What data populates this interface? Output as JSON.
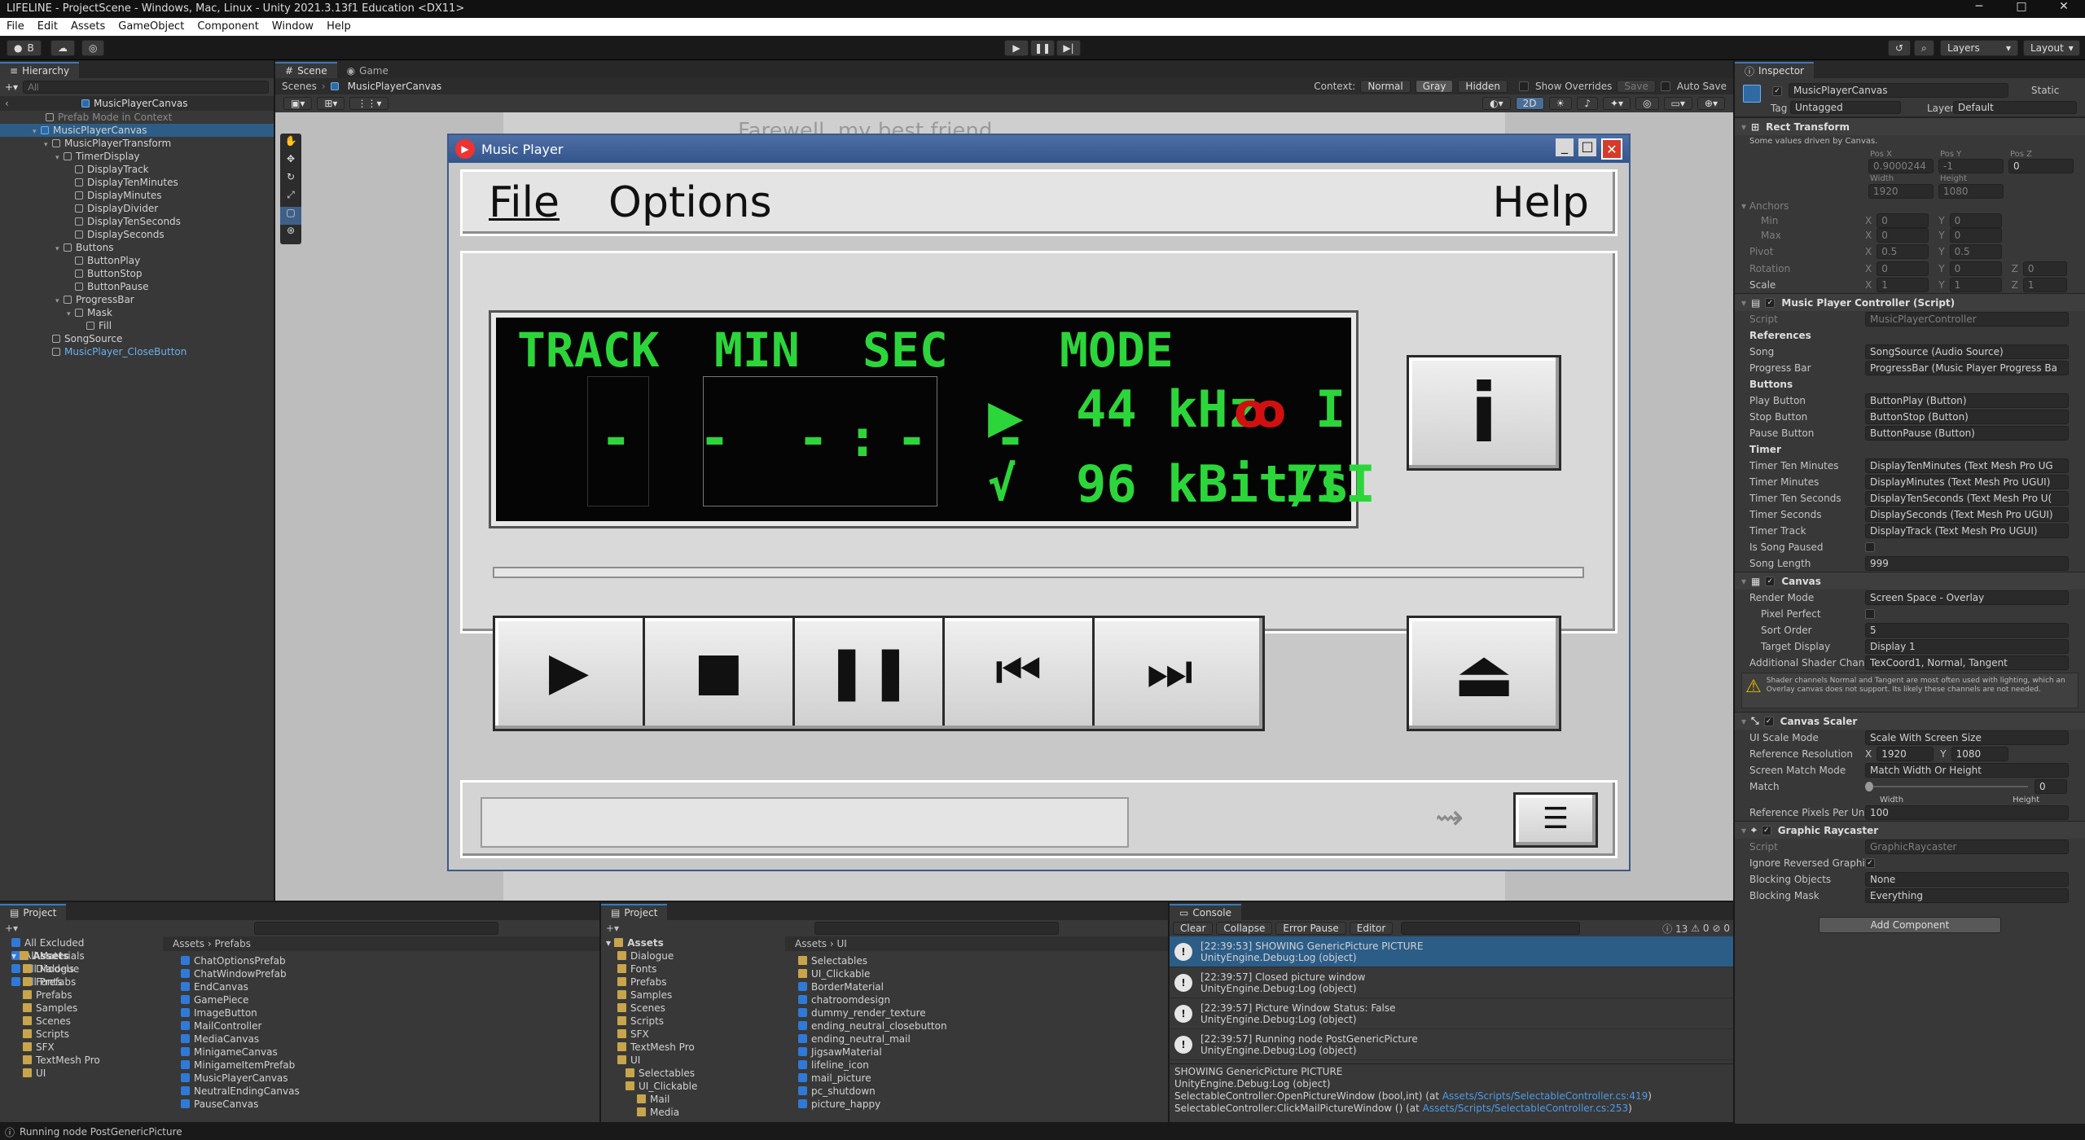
{
  "window": {
    "title": "LIFELINE - ProjectScene - Windows, Mac, Linux - Unity 2021.3.13f1 Education <DX11>",
    "controls": [
      "─",
      "□",
      "✕"
    ]
  },
  "menu": [
    "File",
    "Edit",
    "Assets",
    "GameObject",
    "Component",
    "Window",
    "Help"
  ],
  "toolbar": {
    "account": "B",
    "layers": "Layers",
    "layout": "Layout"
  },
  "hierarchy": {
    "tab": "Hierarchy",
    "search_placeholder": "All",
    "root": "MusicPlayerCanvas",
    "mode_label": "Prefab Mode in Context",
    "items": [
      {
        "label": "MusicPlayerCanvas",
        "depth": 1,
        "selected": true
      },
      {
        "label": "MusicPlayerTransform",
        "depth": 2
      },
      {
        "label": "TimerDisplay",
        "depth": 3
      },
      {
        "label": "DisplayTrack",
        "depth": 4
      },
      {
        "label": "DisplayTenMinutes",
        "depth": 4
      },
      {
        "label": "DisplayMinutes",
        "depth": 4
      },
      {
        "label": "DisplayDivider",
        "depth": 4
      },
      {
        "label": "DisplayTenSeconds",
        "depth": 4
      },
      {
        "label": "DisplaySeconds",
        "depth": 4
      },
      {
        "label": "Buttons",
        "depth": 3
      },
      {
        "label": "ButtonPlay",
        "depth": 4
      },
      {
        "label": "ButtonStop",
        "depth": 4
      },
      {
        "label": "ButtonPause",
        "depth": 4
      },
      {
        "label": "ProgressBar",
        "depth": 3
      },
      {
        "label": "Mask",
        "depth": 4
      },
      {
        "label": "Fill",
        "depth": 5
      },
      {
        "label": "SongSource",
        "depth": 2
      },
      {
        "label": "MusicPlayer_CloseButton",
        "depth": 2
      }
    ]
  },
  "scene": {
    "tabs": [
      "Scene",
      "Game"
    ],
    "breadcrumb": [
      "Scenes",
      "MusicPlayerCanvas"
    ],
    "context_label": "Context:",
    "context_options": [
      "Normal",
      "Gray",
      "Hidden"
    ],
    "show_overrides": "Show Overrides",
    "save": "Save",
    "auto_save": "Auto Save",
    "mode2d": "2D",
    "bg_text": "Farewell, my best friend"
  },
  "music_player": {
    "title": "Music Player",
    "menu": [
      "File",
      "Options",
      "Help"
    ],
    "lcd_headers": [
      "TRACK",
      "MIN",
      "SEC",
      "MODE"
    ],
    "lcd_digits": "-  - -:- -",
    "freq": "44 kHz",
    "stereo": "I",
    "bitrate": "96 kBit/s",
    "check": "√",
    "level": "III",
    "info_btn": "i",
    "transport": [
      "▶",
      "■",
      "❚❚",
      "⏮",
      "⏭"
    ],
    "eject": "⏏"
  },
  "inspector": {
    "tab": "Inspector",
    "object_name": "MusicPlayerCanvas",
    "static": "Static",
    "tag_label": "Tag",
    "tag_value": "Untagged",
    "layer_label": "Layer",
    "layer_value": "Default",
    "rect": {
      "title": "Rect Transform",
      "note": "Some values driven by Canvas.",
      "pos_labels": [
        "Pos X",
        "Pos Y",
        "Pos Z"
      ],
      "pos_values": [
        "0.9000244",
        "-1",
        "0"
      ],
      "size_labels": [
        "Width",
        "Height"
      ],
      "size_values": [
        "1920",
        "1080"
      ],
      "anchors": "Anchors",
      "min": "Min",
      "min_x": "0",
      "min_y": "0",
      "max": "Max",
      "max_x": "0",
      "max_y": "0",
      "pivot": "Pivot",
      "pivot_x": "0.5",
      "pivot_y": "0.5",
      "rotation": "Rotation",
      "rot": [
        "0",
        "0",
        "0"
      ],
      "scale": "Scale",
      "scl": [
        "1",
        "1",
        "1"
      ]
    },
    "controller": {
      "title": "Music Player Controller (Script)",
      "script_label": "Script",
      "script_value": "MusicPlayerController",
      "references": "References",
      "song_label": "Song",
      "song_value": "SongSource (Audio Source)",
      "progress_label": "Progress Bar",
      "progress_value": "ProgressBar (Music Player Progress Ba",
      "buttons": "Buttons",
      "play_label": "Play Button",
      "play_value": "ButtonPlay (Button)",
      "stop_label": "Stop Button",
      "stop_value": "ButtonStop (Button)",
      "pause_label": "Pause Button",
      "pause_value": "ButtonPause (Button)",
      "timer": "Timer",
      "tt_label": "Timer Ten Minutes",
      "tt_value": "DisplayTenMinutes (Text Mesh Pro UG",
      "tm_label": "Timer Minutes",
      "tm_value": "DisplayMinutes (Text Mesh Pro UGUI)",
      "ts_label": "Timer Ten Seconds",
      "ts_value": "DisplayTenSeconds (Text Mesh Pro U(",
      "tsec_label": "Timer Seconds",
      "tsec_value": "DisplaySeconds (Text Mesh Pro UGUI)",
      "ttrack_label": "Timer Track",
      "ttrack_value": "DisplayTrack (Text Mesh Pro UGUI)",
      "paused_label": "Is Song Paused",
      "length_label": "Song Length",
      "length_value": "999"
    },
    "canvas": {
      "title": "Canvas",
      "render_label": "Render Mode",
      "render_value": "Screen Space - Overlay",
      "pixel_label": "Pixel Perfect",
      "sort_label": "Sort Order",
      "sort_value": "5",
      "target_label": "Target Display",
      "target_value": "Display 1",
      "shader_label": "Additional Shader Channels",
      "shader_value": "TexCoord1, Normal, Tangent",
      "warning": "Shader channels Normal and Tangent are most often used with lighting, which an Overlay canvas does not support. Its likely these channels are not needed."
    },
    "scaler": {
      "title": "Canvas Scaler",
      "mode_label": "UI Scale Mode",
      "mode_value": "Scale With Screen Size",
      "ref_label": "Reference Resolution",
      "ref_x": "1920",
      "ref_y": "1080",
      "match_mode_label": "Screen Match Mode",
      "match_mode_value": "Match Width Or Height",
      "match_label": "Match",
      "match_value": "0",
      "match_fraction": 0,
      "width": "Width",
      "height": "Height",
      "ppu_label": "Reference Pixels Per Unit",
      "ppu_value": "100"
    },
    "raycaster": {
      "title": "Graphic Raycaster",
      "script_label": "Script",
      "script_value": "GraphicRaycaster",
      "ignore_label": "Ignore Reversed Graphics",
      "blocking_label": "Blocking Objects",
      "blocking_value": "None",
      "mask_label": "Blocking Mask",
      "mask_value": "Everything"
    },
    "add_component": "Add Component"
  },
  "project1": {
    "tab": "Project",
    "favorites": [
      "All Excluded",
      "All Materials",
      "All Models",
      "All Prefabs"
    ],
    "tree_root": "Assets",
    "tree": [
      "Dialogue",
      "Fonts",
      "Prefabs",
      "Samples",
      "Scenes",
      "Scripts",
      "SFX",
      "TextMesh Pro",
      "UI"
    ],
    "breadcrumb": [
      "Assets",
      "Prefabs"
    ],
    "files": [
      "ChatOptionsPrefab",
      "ChatWindowPrefab",
      "EndCanvas",
      "GamePiece",
      "ImageButton",
      "MailController",
      "MediaCanvas",
      "MinigameCanvas",
      "MinigameItemPrefab",
      "MusicPlayerCanvas",
      "NeutralEndingCanvas",
      "PauseCanvas"
    ]
  },
  "project2": {
    "tab": "Project",
    "tree_root": "Assets",
    "tree": [
      "Dialogue",
      "Fonts",
      "Prefabs",
      "Samples",
      "Scenes",
      "Scripts",
      "SFX",
      "TextMesh Pro",
      "UI",
      "Selectables",
      "UI_Clickable",
      "Mail",
      "Media"
    ],
    "breadcrumb": [
      "Assets",
      "UI"
    ],
    "files": [
      "Selectables",
      "UI_Clickable",
      "BorderMaterial",
      "chatroomdesign",
      "dummy_render_texture",
      "ending_neutral_closebutton",
      "ending_neutral_mail",
      "JigsawMaterial",
      "lifeline_icon",
      "mail_picture",
      "pc_shutdown",
      "picture_happy"
    ]
  },
  "console": {
    "tab": "Console",
    "buttons": [
      "Clear",
      "Collapse",
      "Error Pause",
      "Editor"
    ],
    "counts": [
      "13",
      "0",
      "0"
    ],
    "logs": [
      {
        "line1": "[22:39:53] SHOWING GenericPicture PICTURE",
        "line2": "UnityEngine.Debug:Log (object)",
        "selected": true
      },
      {
        "line1": "[22:39:57] Closed picture window",
        "line2": "UnityEngine.Debug:Log (object)"
      },
      {
        "line1": "[22:39:57] Picture Window Status: False",
        "line2": "UnityEngine.Debug:Log (object)"
      },
      {
        "line1": "[22:39:57] Running node PostGenericPicture",
        "line2": "UnityEngine.Debug:Log (object)"
      }
    ],
    "detail": [
      "SHOWING GenericPicture PICTURE",
      "UnityEngine.Debug:Log (object)",
      "SelectableController:OpenPictureWindow (bool,int) (at ",
      "SelectableController:ClickMailPictureWindow () (at "
    ],
    "detail_links": [
      "Assets/Scripts/SelectableController.cs:419",
      "Assets/Scripts/SelectableController.cs:253"
    ]
  },
  "statusbar": "Running node PostGenericPicture"
}
